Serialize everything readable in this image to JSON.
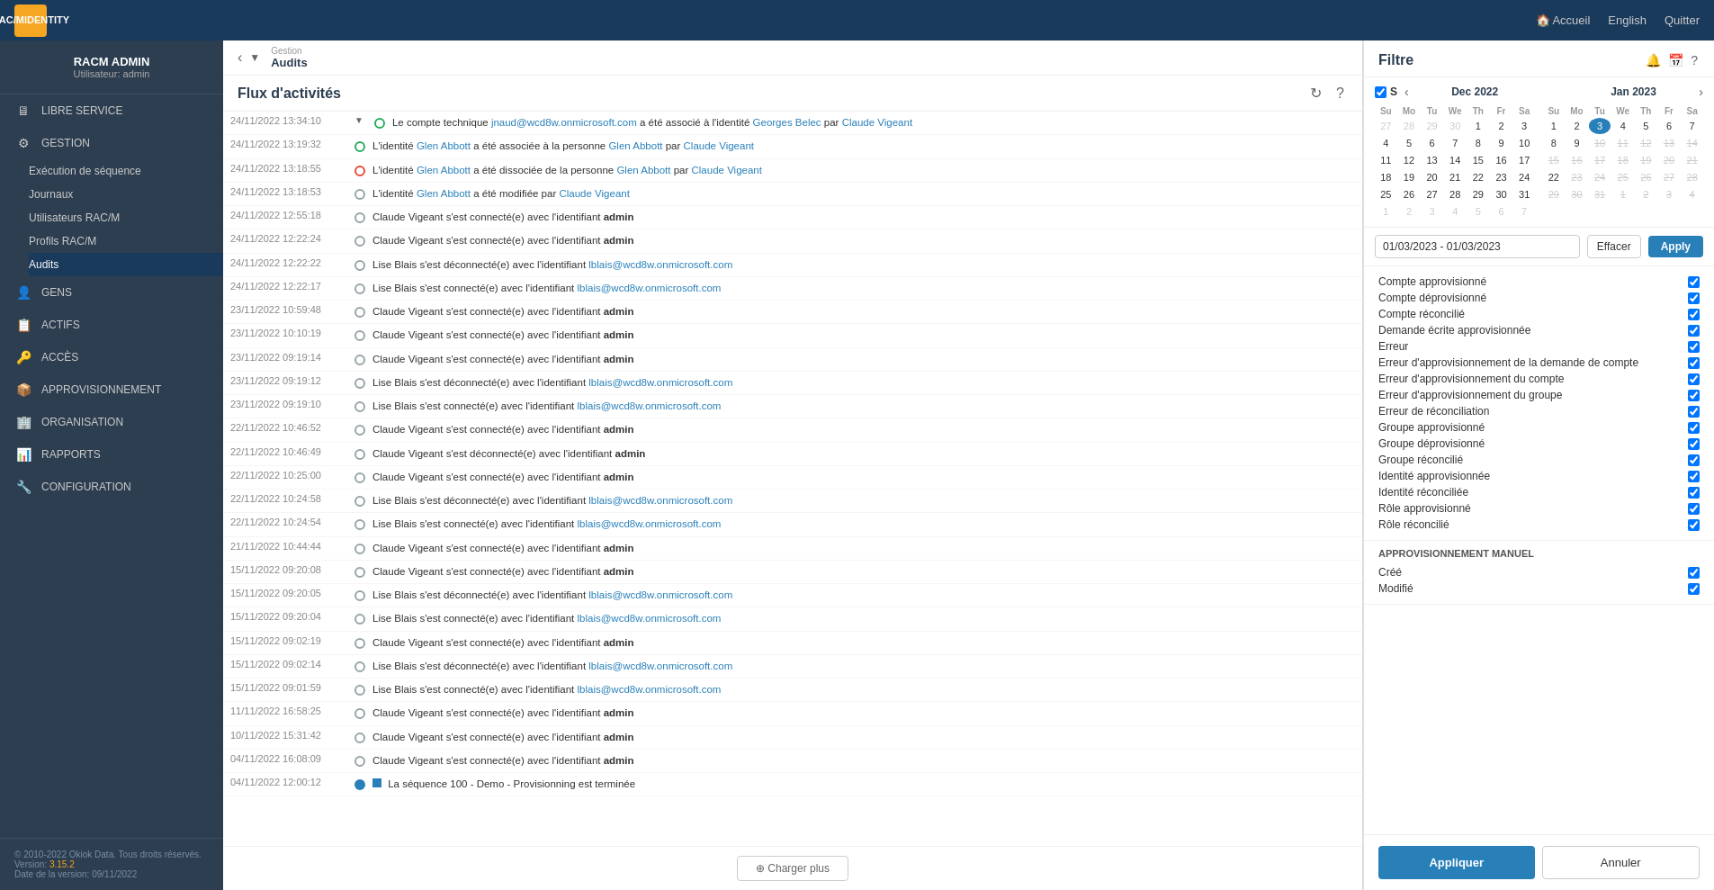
{
  "app": {
    "logo_line1": "RAC/M",
    "logo_line2": "IDENTITY",
    "nav_links": [
      "Accueil",
      "English",
      "Quitter"
    ]
  },
  "sidebar": {
    "username": "RACM ADMIN",
    "role": "Utilisateur: admin",
    "items": [
      {
        "id": "libre-service",
        "label": "LIBRE SERVICE",
        "icon": "🖥"
      },
      {
        "id": "gestion",
        "label": "GESTION",
        "icon": "⚙"
      },
      {
        "id": "execution-sequence",
        "label": "Exécution de séquence",
        "sub": true
      },
      {
        "id": "journaux",
        "label": "Journaux",
        "sub": true
      },
      {
        "id": "utilisateurs-racm",
        "label": "Utilisateurs RAC/M",
        "sub": true
      },
      {
        "id": "profils-racm",
        "label": "Profils RAC/M",
        "sub": true
      },
      {
        "id": "audits",
        "label": "Audits",
        "sub": true,
        "active": true
      },
      {
        "id": "gens",
        "label": "GENS",
        "icon": "👤"
      },
      {
        "id": "actifs",
        "label": "ACTIFS",
        "icon": "📋"
      },
      {
        "id": "acces",
        "label": "ACCÈS",
        "icon": "🔑"
      },
      {
        "id": "approvisionnement",
        "label": "APPROVISIONNEMENT",
        "icon": "📦"
      },
      {
        "id": "organisation",
        "label": "ORGANISATION",
        "icon": "🏢"
      },
      {
        "id": "rapports",
        "label": "RAPPORTS",
        "icon": "📊"
      },
      {
        "id": "configuration",
        "label": "CONFIGURATION",
        "icon": "🔧"
      }
    ],
    "footer": {
      "copyright": "© 2010-2022 Okiok Data. Tous droits réservés.",
      "version_label": "Version:",
      "version": "3.15.2",
      "date_label": "Date de la version:",
      "date": "09/11/2022"
    }
  },
  "breadcrumb": {
    "parent": "Gestion",
    "current": "Audits"
  },
  "activity": {
    "title": "Flux d'activités",
    "load_more": "⊕ Charger plus",
    "rows": [
      {
        "timestamp": "24/11/2022 13:34:10",
        "dot": "green",
        "expand": true,
        "text": "Le compte technique <a class='act-link'>jnaud@wcd8w.onmicrosoft.com</a> a été associé à l'identité <a class='act-link'>Georges Belec</a> par <a class='act-link'>Claude Vigeant</a>"
      },
      {
        "timestamp": "24/11/2022 13:19:32",
        "dot": "green",
        "text": "L'identité <a class='act-link'>Glen Abbott</a> a été associée à la personne <a class='act-link'>Glen Abbott</a> par <a class='act-link'>Claude Vigeant</a>"
      },
      {
        "timestamp": "24/11/2022 13:18:55",
        "dot": "red",
        "text": "L'identité <a class='act-link'>Glen Abbott</a> a été dissociée de la personne <a class='act-link'>Glen Abbott</a> par <a class='act-link'>Claude Vigeant</a>"
      },
      {
        "timestamp": "24/11/2022 13:18:53",
        "dot": "gray",
        "text": "L'identité <a class='act-link'>Glen Abbott</a> a été modifiée par <a class='act-link'>Claude Vigeant</a>"
      },
      {
        "timestamp": "24/11/2022 12:55:18",
        "dot": "gray",
        "text": "Claude Vigeant s'est connecté(e) avec l'identifiant <strong>admin</strong>"
      },
      {
        "timestamp": "24/11/2022 12:22:24",
        "dot": "gray",
        "text": "Claude Vigeant s'est connecté(e) avec l'identifiant <strong>admin</strong>"
      },
      {
        "timestamp": "24/11/2022 12:22:22",
        "dot": "gray",
        "text": "Lise Blais s'est déconnecté(e) avec l'identifiant <a class='act-link'>lblais@wcd8w.onmicrosoft.com</a>"
      },
      {
        "timestamp": "24/11/2022 12:22:17",
        "dot": "gray",
        "text": "Lise Blais s'est connecté(e) avec l'identifiant <a class='act-link'>lblais@wcd8w.onmicrosoft.com</a>"
      },
      {
        "timestamp": "23/11/2022 10:59:48",
        "dot": "gray",
        "text": "Claude Vigeant s'est connecté(e) avec l'identifiant <strong>admin</strong>"
      },
      {
        "timestamp": "23/11/2022 10:10:19",
        "dot": "gray",
        "text": "Claude Vigeant s'est connecté(e) avec l'identifiant <strong>admin</strong>"
      },
      {
        "timestamp": "23/11/2022 09:19:14",
        "dot": "gray",
        "text": "Claude Vigeant s'est connecté(e) avec l'identifiant <strong>admin</strong>"
      },
      {
        "timestamp": "23/11/2022 09:19:12",
        "dot": "gray",
        "text": "Lise Blais s'est déconnecté(e) avec l'identifiant <a class='act-link'>lblais@wcd8w.onmicrosoft.com</a>"
      },
      {
        "timestamp": "23/11/2022 09:19:10",
        "dot": "gray",
        "text": "Lise Blais s'est connecté(e) avec l'identifiant <a class='act-link'>lblais@wcd8w.onmicrosoft.com</a>"
      },
      {
        "timestamp": "22/11/2022 10:46:52",
        "dot": "gray",
        "text": "Claude Vigeant s'est connecté(e) avec l'identifiant <strong>admin</strong>"
      },
      {
        "timestamp": "22/11/2022 10:46:49",
        "dot": "gray",
        "text": "Claude Vigeant s'est déconnecté(e) avec l'identifiant <strong>admin</strong>"
      },
      {
        "timestamp": "22/11/2022 10:25:00",
        "dot": "gray",
        "text": "Claude Vigeant s'est connecté(e) avec l'identifiant <strong>admin</strong>"
      },
      {
        "timestamp": "22/11/2022 10:24:58",
        "dot": "gray",
        "text": "Lise Blais s'est déconnecté(e) avec l'identifiant <a class='act-link'>lblais@wcd8w.onmicrosoft.com</a>"
      },
      {
        "timestamp": "22/11/2022 10:24:54",
        "dot": "gray",
        "text": "Lise Blais s'est connecté(e) avec l'identifiant <a class='act-link'>lblais@wcd8w.onmicrosoft.com</a>"
      },
      {
        "timestamp": "21/11/2022 10:44:44",
        "dot": "gray",
        "text": "Claude Vigeant s'est connecté(e) avec l'identifiant <strong>admin</strong>"
      },
      {
        "timestamp": "15/11/2022 09:20:08",
        "dot": "gray",
        "text": "Claude Vigeant s'est connecté(e) avec l'identifiant <strong>admin</strong>"
      },
      {
        "timestamp": "15/11/2022 09:20:05",
        "dot": "gray",
        "text": "Lise Blais s'est déconnecté(e) avec l'identifiant <a class='act-link'>lblais@wcd8w.onmicrosoft.com</a>"
      },
      {
        "timestamp": "15/11/2022 09:20:04",
        "dot": "gray",
        "text": "Lise Blais s'est connecté(e) avec l'identifiant <a class='act-link'>lblais@wcd8w.onmicrosoft.com</a>"
      },
      {
        "timestamp": "15/11/2022 09:02:19",
        "dot": "gray",
        "text": "Claude Vigeant s'est connecté(e) avec l'identifiant <strong>admin</strong>"
      },
      {
        "timestamp": "15/11/2022 09:02:14",
        "dot": "gray",
        "text": "Lise Blais s'est déconnecté(e) avec l'identifiant <a class='act-link'>lblais@wcd8w.onmicrosoft.com</a>"
      },
      {
        "timestamp": "15/11/2022 09:01:59",
        "dot": "gray",
        "text": "Lise Blais s'est connecté(e) avec l'identifiant <a class='act-link'>lblais@wcd8w.onmicrosoft.com</a>"
      },
      {
        "timestamp": "11/11/2022 16:58:25",
        "dot": "gray",
        "text": "Claude Vigeant s'est connecté(e) avec l'identifiant <strong>admin</strong>"
      },
      {
        "timestamp": "10/11/2022 15:31:42",
        "dot": "gray",
        "text": "Claude Vigeant s'est connecté(e) avec l'identifiant <strong>admin</strong>"
      },
      {
        "timestamp": "04/11/2022 16:08:09",
        "dot": "gray",
        "text": "Claude Vigeant s'est connecté(e) avec l'identifiant <strong>admin</strong>"
      },
      {
        "timestamp": "04/11/2022 12:00:12",
        "dot": "blue",
        "text": "<span class='blue-sq'></span> La séquence 100 - Demo - Provisionning est terminée"
      }
    ]
  },
  "filter": {
    "title": "Filtre",
    "calendar": {
      "month1": "Dec 2022",
      "month2": "Jan 2023",
      "days_header": [
        "Su",
        "Mo",
        "Tu",
        "We",
        "Th",
        "Fr",
        "Sa"
      ],
      "checkbox_label": "S",
      "dec_weeks": [
        [
          27,
          28,
          29,
          30,
          1,
          2,
          3
        ],
        [
          4,
          5,
          6,
          7,
          8,
          9,
          10
        ],
        [
          11,
          12,
          13,
          14,
          15,
          16,
          17
        ],
        [
          18,
          19,
          20,
          21,
          22,
          23,
          24
        ],
        [
          25,
          26,
          27,
          28,
          29,
          30,
          31
        ],
        [
          1,
          2,
          3,
          4,
          5,
          6,
          7
        ]
      ],
      "jan_weeks": [
        [
          1,
          2,
          3,
          4,
          5,
          6,
          7
        ],
        [
          8,
          9,
          10,
          11,
          12,
          13,
          14
        ],
        [
          15,
          16,
          17,
          18,
          19,
          20,
          21
        ],
        [
          22,
          23,
          24,
          25,
          26,
          27,
          28
        ],
        [
          29,
          30,
          31,
          1,
          2,
          3,
          4
        ]
      ]
    },
    "date_range": "01/03/2023 - 01/03/2023",
    "btn_effacer": "Effacer",
    "btn_apply": "Apply",
    "sections": [
      {
        "id": "act",
        "items": [
          {
            "label": "Compte approvisionné",
            "checked": true
          },
          {
            "label": "Compte déprovisionné",
            "checked": true
          },
          {
            "label": "Compte réconcilié",
            "checked": true
          },
          {
            "label": "Demande écrite approvisionnée",
            "checked": true
          },
          {
            "label": "Erreur",
            "checked": true
          },
          {
            "label": "Erreur d'approvisionnement de la demande de compte",
            "checked": true
          },
          {
            "label": "Erreur d'approvisionnement du compte",
            "checked": true
          },
          {
            "label": "Erreur d'approvisionnement du groupe",
            "checked": true
          },
          {
            "label": "Erreur de réconciliation",
            "checked": true
          },
          {
            "label": "Groupe approvisionné",
            "checked": true
          },
          {
            "label": "Groupe déprovisionné",
            "checked": true
          },
          {
            "label": "Groupe réconcilié",
            "checked": true
          },
          {
            "label": "Identité approvisionnée",
            "checked": true
          },
          {
            "label": "Identité réconciliée",
            "checked": true
          },
          {
            "label": "Rôle approvisionné",
            "checked": true
          },
          {
            "label": "Rôle réconcilié",
            "checked": true
          }
        ]
      },
      {
        "id": "approvisionnement-manuel",
        "title": "APPROVISIONNEMENT MANUEL",
        "items": [
          {
            "label": "Créé",
            "checked": true
          },
          {
            "label": "Modifié",
            "checked": true
          }
        ]
      }
    ],
    "btn_appliquer": "Appliquer",
    "btn_annuler": "Annuler"
  }
}
